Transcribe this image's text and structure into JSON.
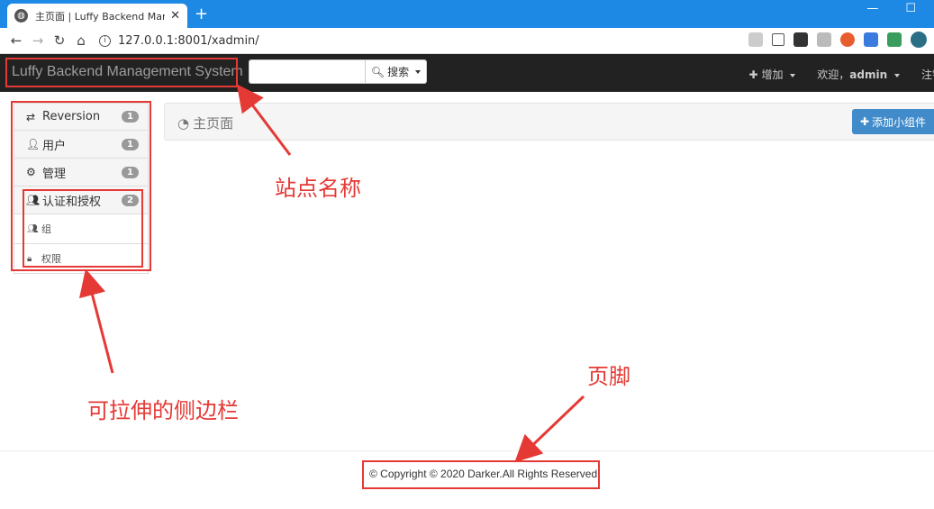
{
  "browser": {
    "tab_title": "主页面 | Luffy Backend Manage",
    "close_glyph": "✕",
    "new_tab_glyph": "+",
    "url": "127.0.0.1:8001/xadmin/",
    "info_glyph": "i"
  },
  "navbar": {
    "brand": "Luffy Backend Management System",
    "search_placeholder": "",
    "search_button": "搜索",
    "add_menu": "增加",
    "welcome_prefix": "欢迎，",
    "welcome_user": "admin",
    "logout": "注销"
  },
  "sidebar": {
    "items": [
      {
        "label": "Reversion",
        "badge": "1",
        "icon": "exchange-icon"
      },
      {
        "label": "用户",
        "badge": "1",
        "icon": "user-icon"
      },
      {
        "label": "管理",
        "badge": "1",
        "icon": "gear-icon"
      },
      {
        "label": "认证和授权",
        "badge": "2",
        "icon": "group-icon"
      }
    ],
    "sub_items": [
      {
        "label": "组",
        "icon": "group-icon"
      },
      {
        "label": "权限",
        "icon": "lock-icon"
      }
    ]
  },
  "main": {
    "page_title": "主页面",
    "add_widget_label": "添加小组件"
  },
  "footer": {
    "text": "© Copyright © 2020 Darker.All Rights Reserved"
  },
  "annotations": {
    "site_name": "站点名称",
    "sidebar": "可拉伸的侧边栏",
    "footer": "页脚"
  },
  "colors": {
    "accent": "#428bca",
    "navbar_bg": "#222222",
    "annotation": "#e53935",
    "browser_bar": "#1e88e5"
  }
}
